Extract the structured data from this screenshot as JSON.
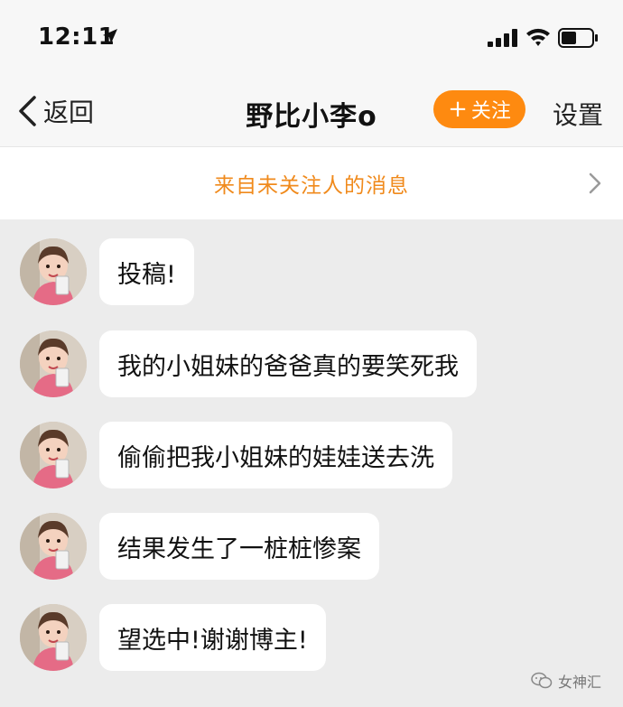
{
  "status_bar": {
    "time": "12:11"
  },
  "nav": {
    "back_label": "返回",
    "title": "野比小李o",
    "follow_label": "关注",
    "settings_label": "设置"
  },
  "banner": {
    "text": "来自未关注人的消息"
  },
  "messages": [
    {
      "text": "投稿!"
    },
    {
      "text": "我的小姐妹的爸爸真的要笑死我"
    },
    {
      "text": "偷偷把我小姐妹的娃娃送去洗"
    },
    {
      "text": "结果发生了一桩桩惨案"
    },
    {
      "text": "望选中!谢谢博主!"
    }
  ],
  "watermark": {
    "label": "女神汇"
  },
  "colors": {
    "accent": "#fe8a10",
    "banner_text": "#f08a1c",
    "chat_bg": "#ececec"
  },
  "icons": [
    "location-arrow-icon",
    "signal-icon",
    "wifi-icon",
    "battery-icon",
    "back-chevron-icon",
    "chevron-right-icon",
    "avatar",
    "wechat-icon"
  ]
}
